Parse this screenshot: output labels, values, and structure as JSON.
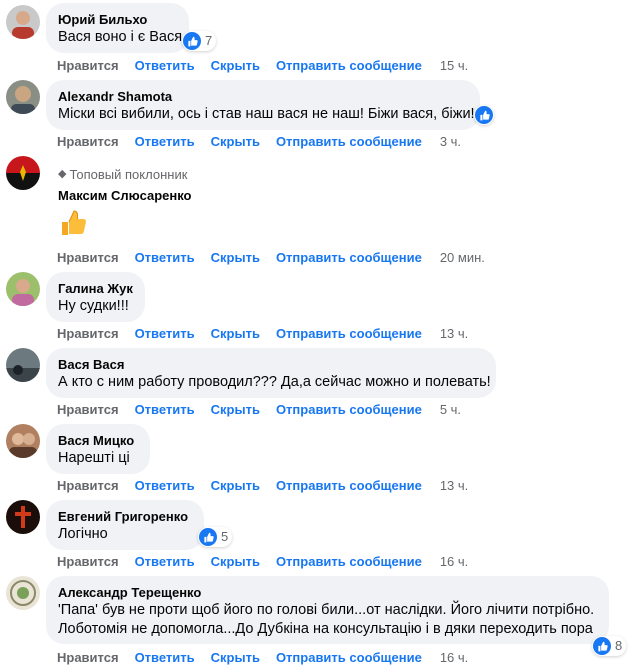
{
  "actions": {
    "like": "Нравится",
    "reply": "Ответить",
    "hide": "Скрыть",
    "message": "Отправить сообщение"
  },
  "colors": {
    "link": "#1877f2",
    "muted": "#65676b",
    "bubble": "#f0f2f5"
  },
  "comments": [
    {
      "name": "Юрий Бильхо",
      "text": "Вася воно і є Вася.",
      "reactions": "7",
      "time": "15 ч."
    },
    {
      "name": "Alexandr Shamota",
      "text": "Міски всі вибили, ось і став наш вася не наш! Біжи вася, біжи!",
      "reactions": "",
      "time": "3 ч."
    },
    {
      "badge": "Топовый поклонник",
      "badge_icon": "diamond-icon",
      "name": "Максим Слюсаренко",
      "emoji": "thumbs-up-emoji",
      "time": "20 мин."
    },
    {
      "name": "Галина Жук",
      "text": "Ну судки!!!",
      "time": "13 ч."
    },
    {
      "name": "Вася Вася",
      "text": "А кто с ним работу проводил??? Да,а сейчас можно и полевать!",
      "time": "5 ч."
    },
    {
      "name": "Вася Мицко",
      "text": "Нарешті ці",
      "time": "13 ч."
    },
    {
      "name": "Евгений Григоренко",
      "text": "Логічно",
      "reactions": "5",
      "time": "16 ч."
    },
    {
      "name": "Александр Терещенко",
      "text1": "'Папа' був не проти щоб його по голові били...от наслідки. Його лічити потрібно.",
      "text2": "Лоботомія не допомогла...До Дубкіна на консультацію і в дяки переходить пора",
      "reactions": "8",
      "time": "16 ч."
    }
  ]
}
